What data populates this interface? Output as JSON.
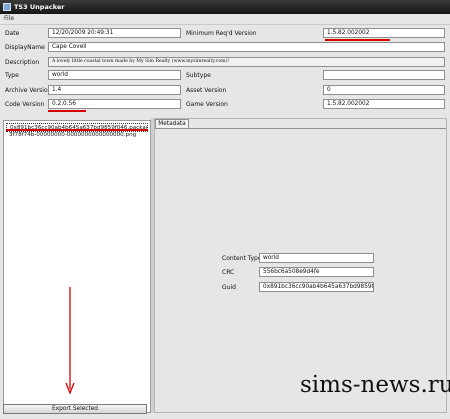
{
  "window": {
    "title": "TS3 Unpacker"
  },
  "menu": {
    "file": "File"
  },
  "header": {
    "date": {
      "label": "Date",
      "value": "12/20/2009 20:49:31"
    },
    "min_version": {
      "label": "Minimum Req'd Version",
      "value": "1.5.82.002002"
    },
    "display_name": {
      "label": "DisplayName",
      "value": "Cape Covell"
    },
    "description": {
      "label": "Description",
      "value": "A lovely little coastal town made by My Sim Realty (www.mysimrealty.com)!"
    },
    "type": {
      "label": "Type",
      "value": "world"
    },
    "subtype": {
      "label": "Subtype",
      "value": ""
    },
    "archive_version": {
      "label": "Archive Version",
      "value": "1.4"
    },
    "asset_version": {
      "label": "Asset Version",
      "value": "0"
    },
    "code_version": {
      "label": "Code Version",
      "value": "0.2.0.56"
    },
    "game_version": {
      "label": "Game Version",
      "value": "1.5.82.002002"
    }
  },
  "files": [
    {
      "name": "0x891bc36cc90ab4b645a637bd9859f046.package",
      "selected": true
    },
    {
      "name": "3f78f74b-00000000-0000000000000000.png",
      "selected": false
    }
  ],
  "export_button": "Export Selected",
  "tabs": {
    "metadata": "Metadata"
  },
  "metadata": {
    "content_type": {
      "label": "Content Type",
      "value": "world"
    },
    "crc": {
      "label": "CRC",
      "value": "556bc6a508e9d4fe"
    },
    "guid": {
      "label": "Guid",
      "value": "0x891bc36cc90ab4b645a637bd9859f046"
    }
  },
  "watermark": "sims-news.ru",
  "colors": {
    "annotation_red": "#d40000"
  }
}
